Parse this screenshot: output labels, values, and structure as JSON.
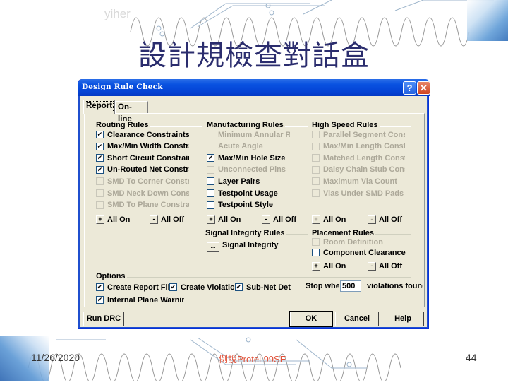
{
  "slide": {
    "watermark": "yiher",
    "title": "設計規檢查對話盒",
    "footer_date": "11/26/2020",
    "footer_center": "例說Protel 99SE",
    "page_number": "44"
  },
  "dialog": {
    "title": "Design Rule Check",
    "help_button": "?",
    "close_button": "✕",
    "tabs": [
      {
        "label": "Report",
        "active": true
      },
      {
        "label": "On-line",
        "active": false
      }
    ],
    "routing_rules": {
      "title": "Routing Rules",
      "items": [
        {
          "label": "Clearance Constraints",
          "checked": true,
          "enabled": true
        },
        {
          "label": "Max/Min Width Constraint",
          "checked": true,
          "enabled": true
        },
        {
          "label": "Short Circuit Constraints",
          "checked": true,
          "enabled": true
        },
        {
          "label": "Un-Routed Net Constraints",
          "checked": true,
          "enabled": true
        },
        {
          "label": "SMD To Corner Constraint",
          "checked": false,
          "enabled": false
        },
        {
          "label": "SMD Neck Down Constraint",
          "checked": false,
          "enabled": false
        },
        {
          "label": "SMD To Plane Constraint",
          "checked": false,
          "enabled": false
        }
      ],
      "all_on": "All On",
      "all_off": "All Off"
    },
    "manufacturing_rules": {
      "title": "Manufacturing Rules",
      "items": [
        {
          "label": "Minimum Annular Ring",
          "checked": false,
          "enabled": false
        },
        {
          "label": "Acute Angle",
          "checked": false,
          "enabled": false
        },
        {
          "label": "Max/Min Hole Size",
          "checked": true,
          "enabled": true
        },
        {
          "label": "Unconnected Pins",
          "checked": false,
          "enabled": false
        },
        {
          "label": "Layer Pairs",
          "checked": false,
          "enabled": true
        },
        {
          "label": "Testpoint Usage",
          "checked": false,
          "enabled": true
        },
        {
          "label": "Testpoint Style",
          "checked": false,
          "enabled": true
        }
      ],
      "all_on": "All On",
      "all_off": "All Off"
    },
    "high_speed_rules": {
      "title": "High Speed Rules",
      "items": [
        {
          "label": "Parallel Segment Constraint",
          "checked": false,
          "enabled": false
        },
        {
          "label": "Max/Min Length Constraint",
          "checked": false,
          "enabled": false
        },
        {
          "label": "Matched Length Constraint",
          "checked": false,
          "enabled": false
        },
        {
          "label": "Daisy Chain Stub Constraint",
          "checked": false,
          "enabled": false
        },
        {
          "label": "Maximum Via Count",
          "checked": false,
          "enabled": false
        },
        {
          "label": "Vias Under SMD Pads",
          "checked": false,
          "enabled": false
        }
      ],
      "all_on": "All On",
      "all_off": "All Off"
    },
    "signal_integrity_rules": {
      "title": "Signal Integrity Rules",
      "button": "...",
      "label": "Signal Integrity"
    },
    "placement_rules": {
      "title": "Placement Rules",
      "items": [
        {
          "label": "Room Definition",
          "checked": false,
          "enabled": false
        },
        {
          "label": "Component Clearance",
          "checked": false,
          "enabled": true
        }
      ],
      "all_on": "All On",
      "all_off": "All Off"
    },
    "options": {
      "title": "Options",
      "items": [
        {
          "label": "Create Report File",
          "checked": true
        },
        {
          "label": "Create Violations",
          "checked": true
        },
        {
          "label": "Sub-Net Details",
          "checked": true
        },
        {
          "label": "Internal Plane Warnings",
          "checked": true
        }
      ],
      "stop_label": "Stop when",
      "stop_value": "500",
      "stop_suffix": "violations found"
    },
    "buttons": {
      "run_drc": "Run DRC",
      "ok": "OK",
      "cancel": "Cancel",
      "help": "Help"
    }
  }
}
